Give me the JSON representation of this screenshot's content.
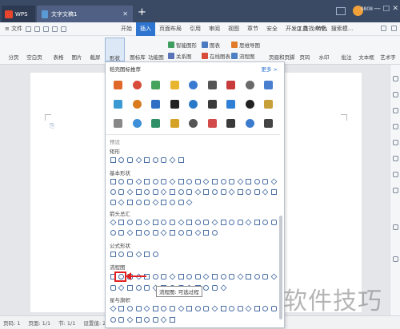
{
  "titlebar": {
    "app_tab": "WPS",
    "doc_tab": "文字文稿1",
    "new_tab_symbol": "+",
    "user_id": "0808",
    "minimize": "—",
    "maximize": "□",
    "close": "✕"
  },
  "menubar": {
    "file_menu": "≡ 文件",
    "tabs": [
      "开始",
      "插入",
      "页面布局",
      "引用",
      "审阅",
      "视图",
      "章节",
      "安全",
      "开发工具",
      "特色"
    ],
    "active_tab": "插入",
    "search_text": "Q 查找命令、搜索模..."
  },
  "toolbar": {
    "buttons": [
      {
        "label": "分页",
        "color": "#5b8fd6"
      },
      {
        "label": "空白页",
        "color": "#6a9ad8"
      },
      {
        "label": "表格",
        "color": "#4b7cc2"
      },
      {
        "label": "图片",
        "color": "#3f9e5f"
      },
      {
        "label": "截屏",
        "color": "#7a86a0"
      },
      {
        "label": "形状",
        "color": "#4d7fc4"
      },
      {
        "label": "图标库",
        "color": "#e07c2a"
      },
      {
        "label": "功能图",
        "color": "#5a73b8"
      }
    ],
    "small_buttons": [
      "智能图形",
      "关系图",
      "图表",
      "在线图表",
      "思维导图",
      "流程图",
      "页眉和页脚",
      "页码",
      "水印",
      "批注",
      "文本框",
      "艺术字"
    ]
  },
  "dropdown": {
    "header": "稻壳图标推荐",
    "more": "更多 >",
    "rec_colors": [
      "#e0682b",
      "#d84a3a",
      "#45a35c",
      "#e8b62e",
      "#3a7ad1",
      "#545454",
      "#c83b3b",
      "#6a6a6a",
      "#4a7fd0",
      "#3a9ad1",
      "#d97a1d",
      "#2e6fc4",
      "#222222",
      "#2a79c9",
      "#3a3a3a",
      "#2f7fd6",
      "#222222",
      "#c7a03a",
      "#888888",
      "#3c8fd8",
      "#2f8f66",
      "#d4a226",
      "#555555",
      "#d24a4a",
      "#3a3a3a",
      "#3d7ccd",
      "#444444"
    ],
    "preset_label": "预设",
    "sections": [
      {
        "title": "矩形"
      },
      {
        "title": "基本形状"
      },
      {
        "title": "箭头总汇"
      },
      {
        "title": "公式形状"
      },
      {
        "title": "流程图"
      },
      {
        "title": "星与旗帜"
      }
    ],
    "tooltip": "流程图: 可选过程"
  },
  "statusbar": {
    "items": [
      "页码: 1",
      "页面: 1/1",
      "节: 1/1",
      "设置值: 2.5厘米"
    ]
  },
  "watermark": "软件技巧",
  "colors": {
    "titlebar": "#3b4a64",
    "accent": "#2e75d0",
    "highlight": "#e02020"
  }
}
